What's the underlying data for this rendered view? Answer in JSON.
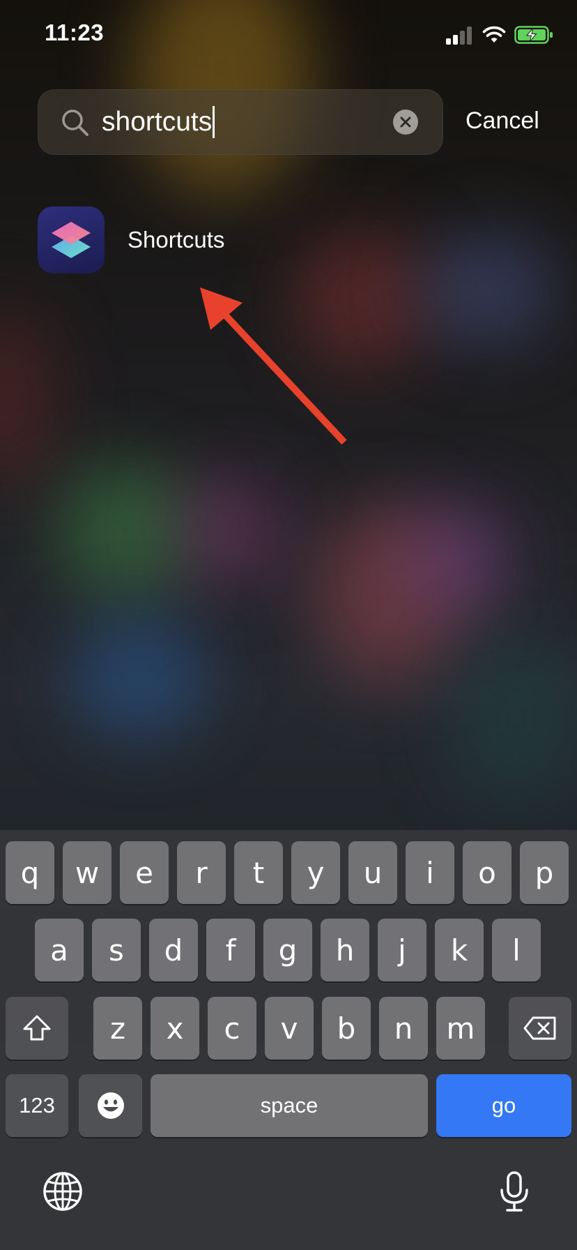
{
  "status_bar": {
    "time": "11:23"
  },
  "search": {
    "query": "shortcuts",
    "cancel_label": "Cancel"
  },
  "result": {
    "app_name": "Shortcuts"
  },
  "keyboard": {
    "rows": [
      [
        "q",
        "w",
        "e",
        "r",
        "t",
        "y",
        "u",
        "i",
        "o",
        "p"
      ],
      [
        "a",
        "s",
        "d",
        "f",
        "g",
        "h",
        "j",
        "k",
        "l"
      ],
      [
        "z",
        "x",
        "c",
        "v",
        "b",
        "n",
        "m"
      ]
    ],
    "numbers_label": "123",
    "space_label": "space",
    "go_label": "go"
  },
  "colors": {
    "accent_blue": "#3478f6",
    "arrow_red": "#e8412c",
    "battery_green": "#5fd35c"
  },
  "icons": {
    "search": "search-icon",
    "clear": "clear-icon",
    "shift": "shift-icon",
    "backspace": "backspace-icon",
    "emoji": "emoji-icon",
    "globe": "globe-icon",
    "microphone": "microphone-icon"
  }
}
